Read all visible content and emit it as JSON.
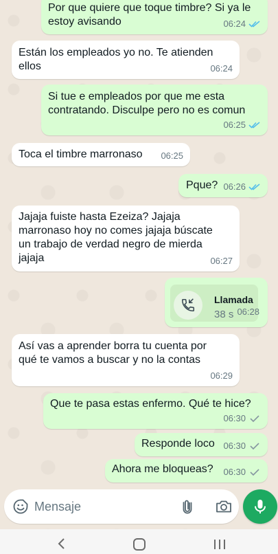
{
  "messages": [
    {
      "id": "m1",
      "dir": "out",
      "text": "Por que quiere que toque timbre? Si ya le estoy avisando",
      "time": "06:24",
      "ticks": "read"
    },
    {
      "id": "m2",
      "dir": "in",
      "text": "Están los empleados yo no. Te atienden ellos",
      "time": "06:24"
    },
    {
      "id": "m3",
      "dir": "out",
      "text": "Si tue e empleados por que me esta contratando. Disculpe pero no es comun",
      "time": "06:25",
      "ticks": "read"
    },
    {
      "id": "m4",
      "dir": "in",
      "text": "Toca el timbre marronaso",
      "time": "06:25"
    },
    {
      "id": "m5",
      "dir": "out",
      "text": "Pque?",
      "time": "06:26",
      "ticks": "read"
    },
    {
      "id": "m6",
      "dir": "in",
      "text": "Jajaja fuiste hasta Ezeiza? Jajaja marronaso hoy no comes jajaja búscate un trabajo de verdad negro de mierda jajaja",
      "time": "06:27"
    },
    {
      "id": "m7",
      "dir": "out",
      "type": "call",
      "title": "Llamada",
      "duration": "38 s",
      "time": "06:28"
    },
    {
      "id": "m8",
      "dir": "in",
      "text": "Así vas a aprender borra tu cuenta por qué te vamos a buscar y no la contas",
      "time": "06:29"
    },
    {
      "id": "m9",
      "dir": "out",
      "text": "Que te pasa estas enfermo. Qué te hice?",
      "time": "06:30",
      "ticks": "sent"
    },
    {
      "id": "m10",
      "dir": "out",
      "text": "Responde loco",
      "time": "06:30",
      "ticks": "sent"
    },
    {
      "id": "m11",
      "dir": "out",
      "text": "Ahora me bloqueas?",
      "time": "06:30",
      "ticks": "sent"
    }
  ],
  "composer": {
    "placeholder": "Mensaje"
  },
  "colors": {
    "outgoing": "#d9fdd3",
    "incoming": "#ffffff",
    "read_tick": "#53bdeb",
    "sent_tick": "#8696a0",
    "mic": "#1daa61"
  },
  "icons": [
    "emoji-icon",
    "attach-icon",
    "camera-icon",
    "mic-icon",
    "call-icon",
    "nav-back-icon",
    "nav-home-icon",
    "nav-recents-icon"
  ]
}
